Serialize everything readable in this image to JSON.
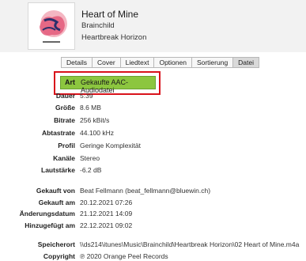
{
  "song": {
    "title": "Heart of Mine",
    "artist": "Brainchild",
    "album": "Heartbreak Horizon"
  },
  "tabs": [
    "Details",
    "Cover",
    "Liedtext",
    "Optionen",
    "Sortierung",
    "Datei"
  ],
  "active_tab": "Datei",
  "kind": {
    "label": "Art",
    "value": "Gekaufte AAC-Audiodatei"
  },
  "properties": [
    {
      "label": "Dauer",
      "value": "5:39"
    },
    {
      "label": "Größe",
      "value": "8.6 MB"
    },
    {
      "label": "Bitrate",
      "value": "256 kBit/s"
    },
    {
      "label": "Abtastrate",
      "value": "44.100 kHz"
    },
    {
      "label": "Profil",
      "value": "Geringe Komplexität"
    },
    {
      "label": "Kanäle",
      "value": "Stereo"
    },
    {
      "label": "Lautstärke",
      "value": "-6.2 dB"
    }
  ],
  "purchase": [
    {
      "label": "Gekauft von",
      "value": "Beat Fellmann (beat_fellmann@bluewin.ch)"
    },
    {
      "label": "Gekauft am",
      "value": "20.12.2021 07:26"
    },
    {
      "label": "Änderungsdatum",
      "value": "21.12.2021 14:09"
    },
    {
      "label": "Hinzugefügt am",
      "value": "22.12.2021 09:02"
    }
  ],
  "location": {
    "label": "Speicherort",
    "value": "\\\\ds214\\itunes\\Music\\Brainchild\\Heartbreak Horizon\\02 Heart of Mine.m4a"
  },
  "copyright": {
    "label": "Copyright",
    "value": "℗ 2020 Orange Peel Records"
  },
  "colors": {
    "highlight_border": "#d9121b",
    "kind_background": "#8cc63f"
  }
}
